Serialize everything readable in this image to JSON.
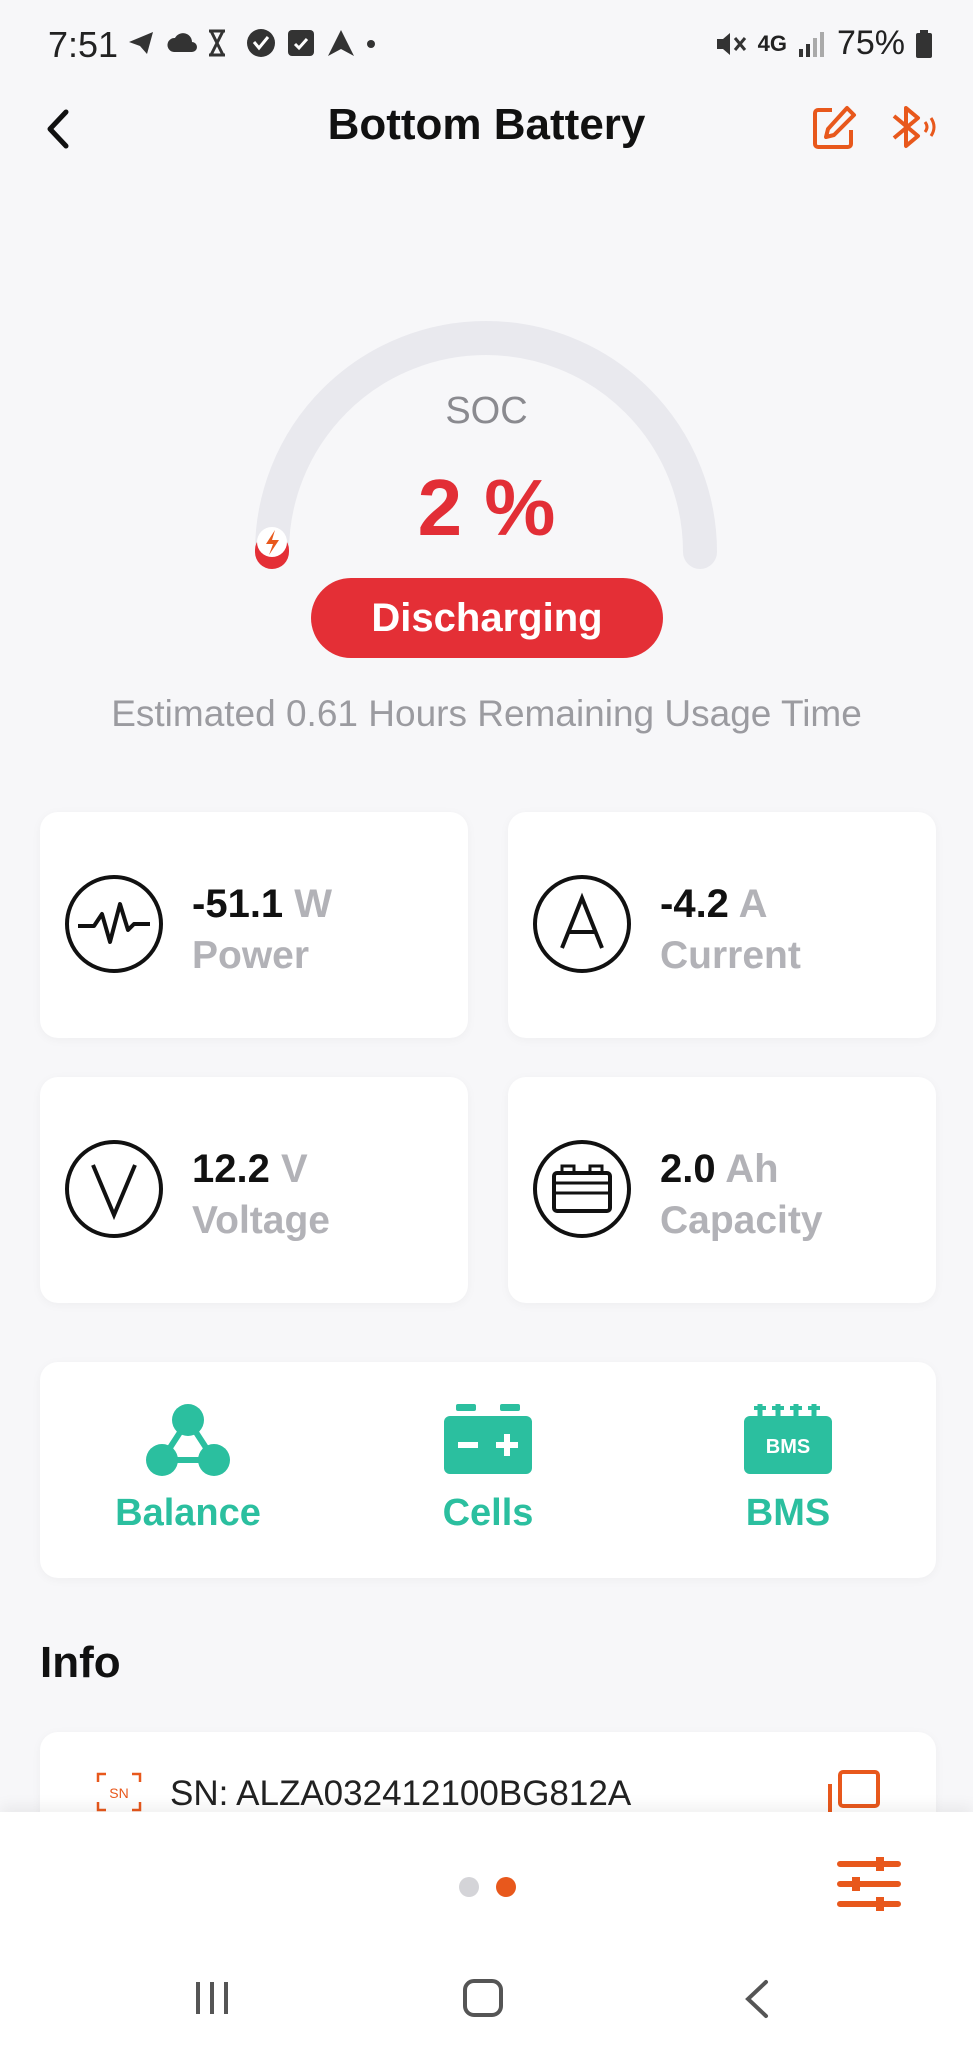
{
  "status_bar": {
    "time": "7:51",
    "network": "4G",
    "battery_percent": "75%",
    "icons": [
      "telegram-icon",
      "cloud-icon",
      "hourglass-icon",
      "vpn-check-icon",
      "call-filter-icon",
      "arrow-app-icon",
      "dot-icon"
    ]
  },
  "header": {
    "title": "Bottom Battery"
  },
  "gauge": {
    "label": "SOC",
    "value_text": "2 %",
    "value_fraction": 0.02,
    "state": "Discharging",
    "estimate": "Estimated 0.61 Hours Remaining Usage Time"
  },
  "metrics": {
    "power": {
      "value": "-51.1",
      "unit": "W",
      "label": "Power"
    },
    "current": {
      "value": "-4.2",
      "unit": "A",
      "label": "Current"
    },
    "voltage": {
      "value": "12.2",
      "unit": "V",
      "label": "Voltage"
    },
    "capacity": {
      "value": "2.0",
      "unit": "Ah",
      "label": "Capacity"
    }
  },
  "actions": {
    "balance": "Balance",
    "cells": "Cells",
    "bms": "BMS",
    "bms_icon_text": "BMS"
  },
  "info": {
    "title": "Info",
    "sn_icon_text": "SN",
    "sn": "SN: ALZA032412100BG812A"
  },
  "pager": {
    "pages": 2,
    "current": 2
  },
  "colors": {
    "accent": "#e8581c",
    "danger": "#e42f36",
    "teal": "#2bbf9f",
    "muted": "#b2b2b7"
  }
}
